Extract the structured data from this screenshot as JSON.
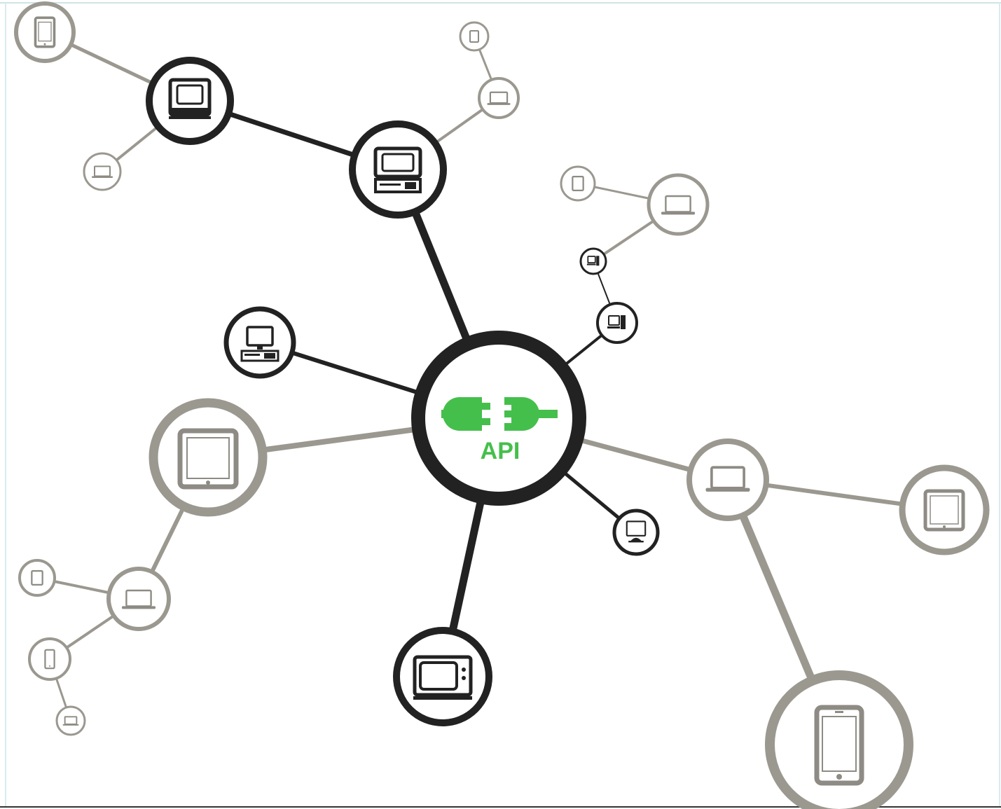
{
  "hub": {
    "label": "API",
    "icon": "plug-connector-icon",
    "color": "#45bf4b"
  },
  "colors": {
    "active": "#222222",
    "inactive": "#9b9890"
  },
  "nodes": {
    "active": [
      "retro-computer-icon",
      "retro-computer-icon",
      "desktop-computer-icon",
      "television-icon",
      "desktop-computer-icon",
      "desktop-computer-icon",
      "monitor-icon"
    ],
    "inactive": [
      "tablet-icon",
      "laptop-icon",
      "tablet-icon",
      "phone-icon",
      "laptop-icon",
      "phone-icon",
      "tablet-icon",
      "laptop-icon",
      "tablet-icon",
      "laptop-icon",
      "phone-icon",
      "laptop-icon"
    ]
  }
}
